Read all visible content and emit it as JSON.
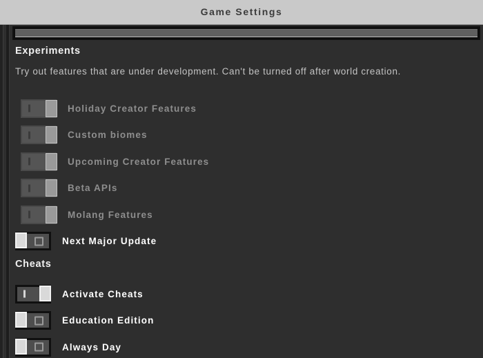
{
  "window": {
    "title": "Game Settings"
  },
  "colors": {
    "titlebar_bg": "#c9c9c9",
    "titlebar_text": "#3b3b3b",
    "body_bg": "#2e2e2e",
    "heading_text": "#f0f0f0",
    "description_text": "#c3c3c3",
    "label_enabled": "#ffffff",
    "label_disabled": "#8e8e8e",
    "toggle_thumb_enabled": "#d9d9d9",
    "toggle_thumb_disabled": "#9a9a9a"
  },
  "scroll_strip": {
    "name": "horizontal-scroll-strip",
    "fill_percent": 100
  },
  "sections": [
    {
      "id": "experiments",
      "heading": "Experiments",
      "description": "Try out features that are under development. Can't be turned off after world creation.",
      "rows": [
        {
          "label": "Holiday Creator Features",
          "state": "on",
          "enabled": false,
          "glyph": "bar"
        },
        {
          "label": "Custom biomes",
          "state": "on",
          "enabled": false,
          "glyph": "bar"
        },
        {
          "label": "Upcoming Creator Features",
          "state": "on",
          "enabled": false,
          "glyph": "bar"
        },
        {
          "label": "Beta APIs",
          "state": "on",
          "enabled": false,
          "glyph": "bar"
        },
        {
          "label": "Molang Features",
          "state": "on",
          "enabled": false,
          "glyph": "bar"
        },
        {
          "label": "Next Major Update",
          "state": "off",
          "enabled": true,
          "glyph": "square"
        }
      ]
    },
    {
      "id": "cheats",
      "heading": "Cheats",
      "description": "",
      "rows": [
        {
          "label": "Activate Cheats",
          "state": "on",
          "enabled": true,
          "glyph": "bar"
        },
        {
          "label": "Education Edition",
          "state": "off",
          "enabled": true,
          "glyph": "square"
        },
        {
          "label": "Always Day",
          "state": "off",
          "enabled": true,
          "glyph": "square"
        }
      ]
    }
  ]
}
